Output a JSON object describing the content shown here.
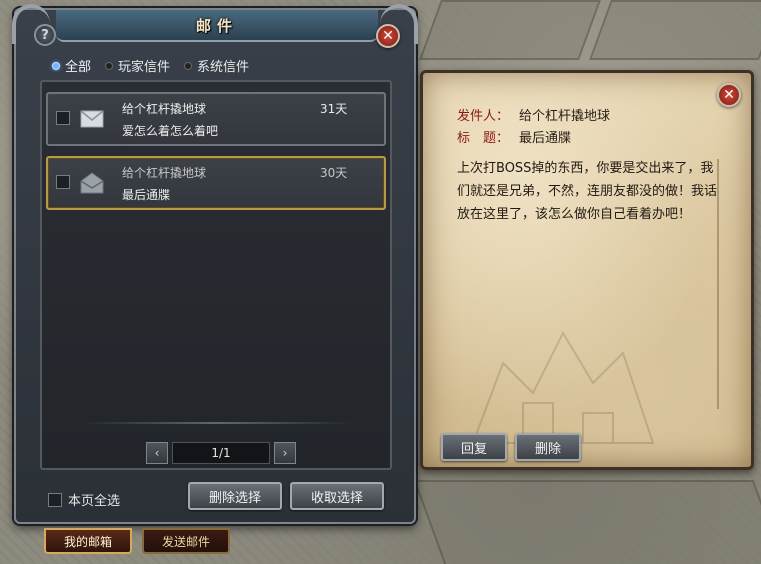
{
  "window": {
    "title": "邮件"
  },
  "tabs": [
    {
      "label": "全部",
      "active": true
    },
    {
      "label": "玩家信件",
      "active": false
    },
    {
      "label": "系统信件",
      "active": false
    }
  ],
  "mails": [
    {
      "sender": "给个杠杆撬地球",
      "subject": "爱怎么着怎么着吧",
      "days_left": "31天",
      "read": false,
      "selected": false
    },
    {
      "sender": "给个杠杆撬地球",
      "subject": "最后通牒",
      "days_left": "30天",
      "read": true,
      "selected": true
    }
  ],
  "pager": {
    "value": "1/1"
  },
  "footer": {
    "select_all_label": "本页全选",
    "delete_selected_label": "删除选择",
    "collect_selected_label": "收取选择"
  },
  "bottom_tabs": [
    {
      "label": "我的邮箱",
      "active": true
    },
    {
      "label": "发送邮件",
      "active": false
    }
  ],
  "detail": {
    "sender_label": "发件人：",
    "sender_value": "给个杠杆撬地球",
    "subject_label": "标　题：",
    "subject_value": "最后通牒",
    "body": "上次打BOSS掉的东西，你要是交出来了，我们就还是兄弟，不然，连朋友都没的做！我话放在这里了，该怎么做你自己看着办吧！",
    "reply_label": "回复",
    "delete_label": "删除"
  },
  "colors": {
    "accent_gold": "#b79a44",
    "label_red": "#8a1a0f",
    "tab_active_dot": "#6fb6ff"
  }
}
